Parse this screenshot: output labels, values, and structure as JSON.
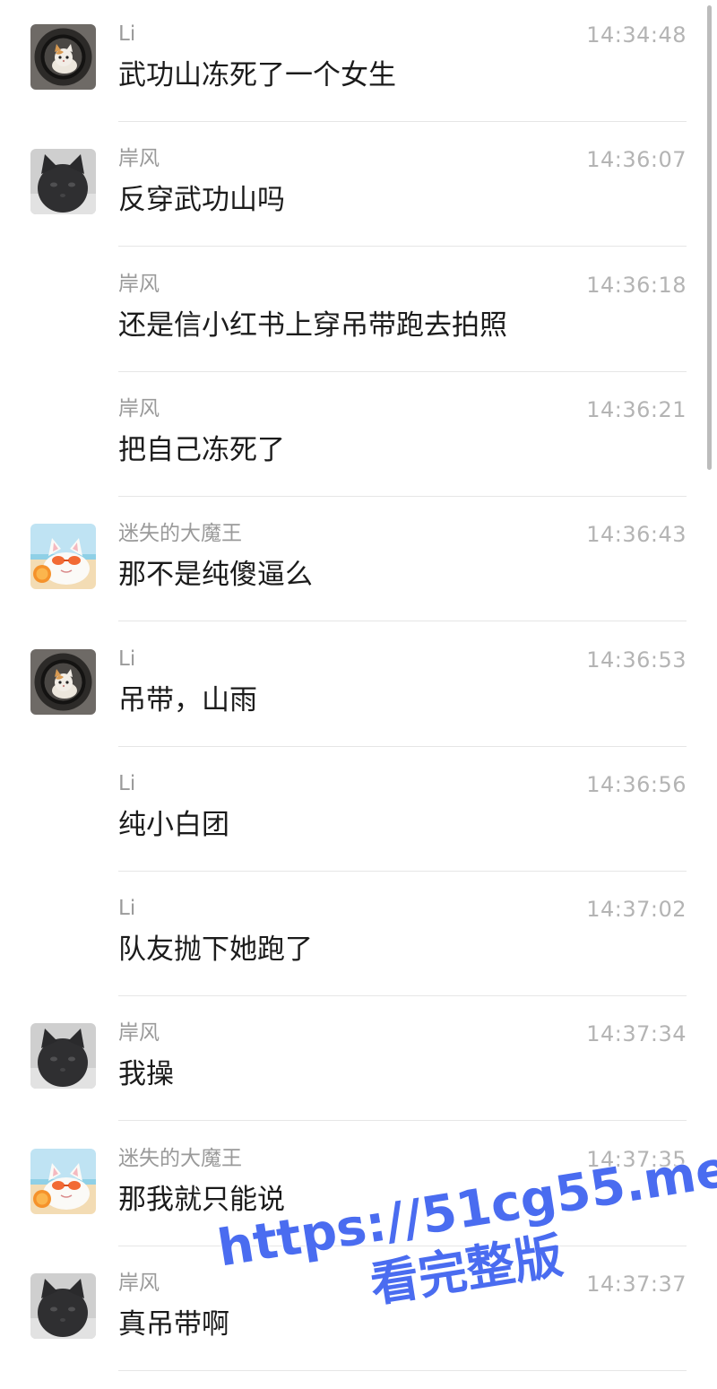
{
  "messages": [
    {
      "sender": "Li",
      "time": "14:34:48",
      "text": "武功山冻死了一个女生",
      "avatar": "cat-in-washer-avatar",
      "show_avatar": true
    },
    {
      "sender": "岸风",
      "time": "14:36:07",
      "text": "反穿武功山吗",
      "avatar": "dark-cat-avatar",
      "show_avatar": true
    },
    {
      "sender": "岸风",
      "time": "14:36:18",
      "text": "还是信小红书上穿吊带跑去拍照",
      "avatar": "dark-cat-avatar",
      "show_avatar": false
    },
    {
      "sender": "岸风",
      "time": "14:36:21",
      "text": "把自己冻死了",
      "avatar": "dark-cat-avatar",
      "show_avatar": false
    },
    {
      "sender": "迷失的大魔王",
      "time": "14:36:43",
      "text": "那不是纯傻逼么",
      "avatar": "sunglasses-cat-avatar",
      "show_avatar": true
    },
    {
      "sender": "Li",
      "time": "14:36:53",
      "text": "吊带，山雨",
      "avatar": "cat-in-washer-avatar",
      "show_avatar": true
    },
    {
      "sender": "Li",
      "time": "14:36:56",
      "text": "纯小白团",
      "avatar": "cat-in-washer-avatar",
      "show_avatar": false
    },
    {
      "sender": "Li",
      "time": "14:37:02",
      "text": "队友抛下她跑了",
      "avatar": "cat-in-washer-avatar",
      "show_avatar": false
    },
    {
      "sender": "岸风",
      "time": "14:37:34",
      "text": "我操",
      "avatar": "dark-cat-avatar",
      "show_avatar": true
    },
    {
      "sender": "迷失的大魔王",
      "time": "14:37:35",
      "text": "那我就只能说",
      "avatar": "sunglasses-cat-avatar",
      "show_avatar": true
    },
    {
      "sender": "岸风",
      "time": "14:37:37",
      "text": "真吊带啊",
      "avatar": "dark-cat-avatar",
      "show_avatar": true
    }
  ],
  "watermark": {
    "url": "https://51cg55.me",
    "cta": "看完整版",
    "color": "#4a6cf0"
  },
  "colors": {
    "background": "#ffffff",
    "sender": "#9a9a9a",
    "time": "#b4b4b4",
    "text": "#1b1b1b",
    "divider": "#e6e6e6"
  }
}
